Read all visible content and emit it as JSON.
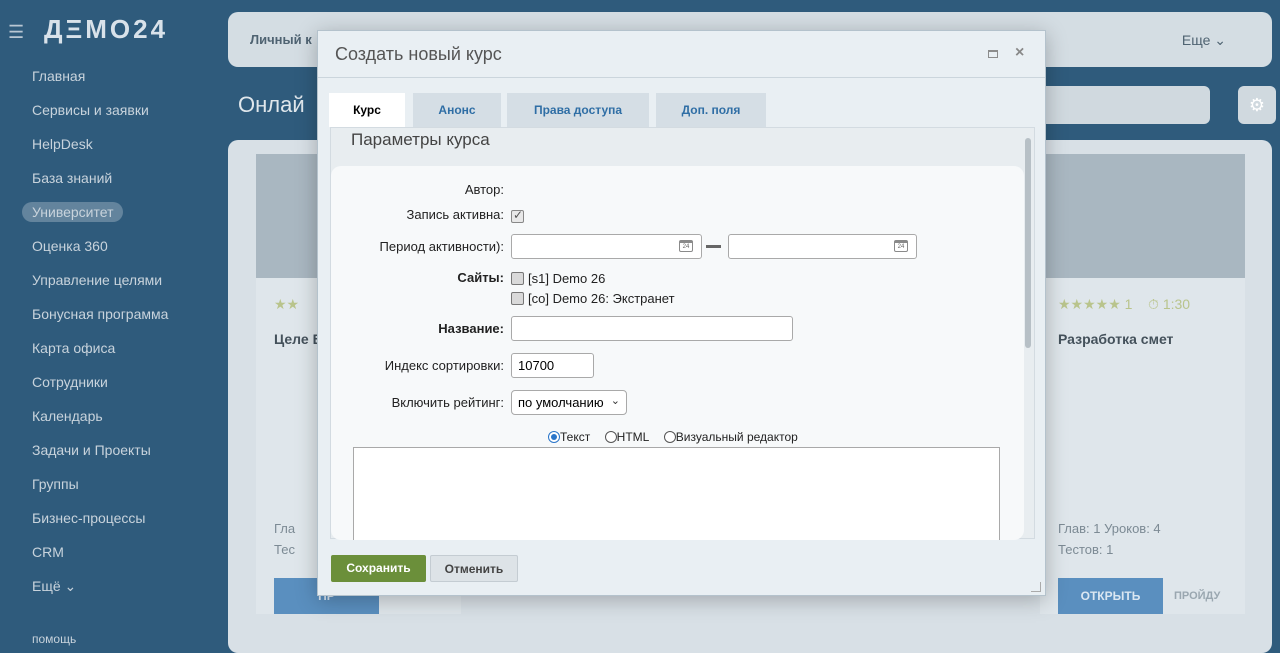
{
  "background": {
    "logo": "ДΞМО24",
    "menu": [
      "Главная",
      "Сервисы и заявки",
      "HelpDesk",
      "База знаний",
      "Университет",
      "Оценка 360",
      "Управление целями",
      "Бонусная программа",
      "Карта офиса",
      "Сотрудники",
      "Календарь",
      "Задачи и Проекты",
      "Группы",
      "Бизнес-процессы",
      "CRM",
      "Ещё ⌄"
    ],
    "help": "помощь",
    "topbar_left": "Личный к",
    "topbar_more": "Еще ⌄",
    "page_title": "Онлай",
    "cards": [
      {
        "title": "Целе Базо",
        "meta1": "Гла",
        "meta2": "Тес",
        "btn": "ПР"
      },
      {
        "title": "Разработка смет",
        "rating": "1",
        "time": "1:30",
        "meta1": "Глав: 1   Уроков: 4",
        "meta2": "Тестов: 1",
        "btn": "ОТКРЫТЬ",
        "pass": "ПРОЙДУ"
      }
    ]
  },
  "modal": {
    "title": "Создать новый курс",
    "tabs": [
      "Курс",
      "Анонс",
      "Права доступа",
      "Доп. поля"
    ],
    "section_title": "Параметры курса",
    "form": {
      "author_label": "Автор:",
      "active_label": "Запись активна:",
      "period_label": "Период активности):",
      "sites_label": "Сайты:",
      "site1": "[s1] Demo 26",
      "site2": "[co] Demo 26: Экстранет",
      "name_label": "Название:",
      "name_value": "",
      "sort_label": "Индекс сортировки:",
      "sort_value": "10700",
      "rating_label": "Включить рейтинг:",
      "rating_value": "по умолчанию",
      "editor_modes": [
        "Текст",
        "HTML",
        "Визуальный редактор"
      ],
      "cal_glyph": "24"
    },
    "buttons": {
      "save": "Сохранить",
      "cancel": "Отменить"
    }
  }
}
